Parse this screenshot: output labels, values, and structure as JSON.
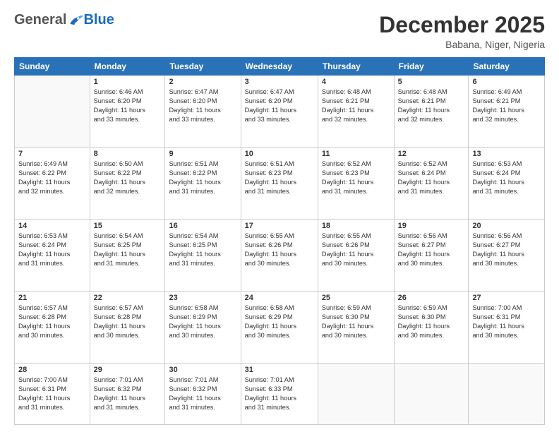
{
  "header": {
    "logo_general": "General",
    "logo_blue": "Blue",
    "month": "December 2025",
    "location": "Babana, Niger, Nigeria"
  },
  "weekdays": [
    "Sunday",
    "Monday",
    "Tuesday",
    "Wednesday",
    "Thursday",
    "Friday",
    "Saturday"
  ],
  "weeks": [
    [
      {
        "day": "",
        "empty": true
      },
      {
        "day": "1",
        "sunrise": "6:46 AM",
        "sunset": "6:20 PM",
        "daylight": "11 hours and 33 minutes."
      },
      {
        "day": "2",
        "sunrise": "6:47 AM",
        "sunset": "6:20 PM",
        "daylight": "11 hours and 33 minutes."
      },
      {
        "day": "3",
        "sunrise": "6:47 AM",
        "sunset": "6:20 PM",
        "daylight": "11 hours and 33 minutes."
      },
      {
        "day": "4",
        "sunrise": "6:48 AM",
        "sunset": "6:21 PM",
        "daylight": "11 hours and 32 minutes."
      },
      {
        "day": "5",
        "sunrise": "6:48 AM",
        "sunset": "6:21 PM",
        "daylight": "11 hours and 32 minutes."
      },
      {
        "day": "6",
        "sunrise": "6:49 AM",
        "sunset": "6:21 PM",
        "daylight": "11 hours and 32 minutes."
      }
    ],
    [
      {
        "day": "7",
        "sunrise": "6:49 AM",
        "sunset": "6:22 PM",
        "daylight": "11 hours and 32 minutes."
      },
      {
        "day": "8",
        "sunrise": "6:50 AM",
        "sunset": "6:22 PM",
        "daylight": "11 hours and 32 minutes."
      },
      {
        "day": "9",
        "sunrise": "6:51 AM",
        "sunset": "6:22 PM",
        "daylight": "11 hours and 31 minutes."
      },
      {
        "day": "10",
        "sunrise": "6:51 AM",
        "sunset": "6:23 PM",
        "daylight": "11 hours and 31 minutes."
      },
      {
        "day": "11",
        "sunrise": "6:52 AM",
        "sunset": "6:23 PM",
        "daylight": "11 hours and 31 minutes."
      },
      {
        "day": "12",
        "sunrise": "6:52 AM",
        "sunset": "6:24 PM",
        "daylight": "11 hours and 31 minutes."
      },
      {
        "day": "13",
        "sunrise": "6:53 AM",
        "sunset": "6:24 PM",
        "daylight": "11 hours and 31 minutes."
      }
    ],
    [
      {
        "day": "14",
        "sunrise": "6:53 AM",
        "sunset": "6:24 PM",
        "daylight": "11 hours and 31 minutes."
      },
      {
        "day": "15",
        "sunrise": "6:54 AM",
        "sunset": "6:25 PM",
        "daylight": "11 hours and 31 minutes."
      },
      {
        "day": "16",
        "sunrise": "6:54 AM",
        "sunset": "6:25 PM",
        "daylight": "11 hours and 31 minutes."
      },
      {
        "day": "17",
        "sunrise": "6:55 AM",
        "sunset": "6:26 PM",
        "daylight": "11 hours and 30 minutes."
      },
      {
        "day": "18",
        "sunrise": "6:55 AM",
        "sunset": "6:26 PM",
        "daylight": "11 hours and 30 minutes."
      },
      {
        "day": "19",
        "sunrise": "6:56 AM",
        "sunset": "6:27 PM",
        "daylight": "11 hours and 30 minutes."
      },
      {
        "day": "20",
        "sunrise": "6:56 AM",
        "sunset": "6:27 PM",
        "daylight": "11 hours and 30 minutes."
      }
    ],
    [
      {
        "day": "21",
        "sunrise": "6:57 AM",
        "sunset": "6:28 PM",
        "daylight": "11 hours and 30 minutes."
      },
      {
        "day": "22",
        "sunrise": "6:57 AM",
        "sunset": "6:28 PM",
        "daylight": "11 hours and 30 minutes."
      },
      {
        "day": "23",
        "sunrise": "6:58 AM",
        "sunset": "6:29 PM",
        "daylight": "11 hours and 30 minutes."
      },
      {
        "day": "24",
        "sunrise": "6:58 AM",
        "sunset": "6:29 PM",
        "daylight": "11 hours and 30 minutes."
      },
      {
        "day": "25",
        "sunrise": "6:59 AM",
        "sunset": "6:30 PM",
        "daylight": "11 hours and 30 minutes."
      },
      {
        "day": "26",
        "sunrise": "6:59 AM",
        "sunset": "6:30 PM",
        "daylight": "11 hours and 30 minutes."
      },
      {
        "day": "27",
        "sunrise": "7:00 AM",
        "sunset": "6:31 PM",
        "daylight": "11 hours and 30 minutes."
      }
    ],
    [
      {
        "day": "28",
        "sunrise": "7:00 AM",
        "sunset": "6:31 PM",
        "daylight": "11 hours and 31 minutes."
      },
      {
        "day": "29",
        "sunrise": "7:01 AM",
        "sunset": "6:32 PM",
        "daylight": "11 hours and 31 minutes."
      },
      {
        "day": "30",
        "sunrise": "7:01 AM",
        "sunset": "6:32 PM",
        "daylight": "11 hours and 31 minutes."
      },
      {
        "day": "31",
        "sunrise": "7:01 AM",
        "sunset": "6:33 PM",
        "daylight": "11 hours and 31 minutes."
      },
      {
        "day": "",
        "empty": true
      },
      {
        "day": "",
        "empty": true
      },
      {
        "day": "",
        "empty": true
      }
    ]
  ],
  "labels": {
    "sunrise": "Sunrise:",
    "sunset": "Sunset:",
    "daylight": "Daylight:"
  }
}
